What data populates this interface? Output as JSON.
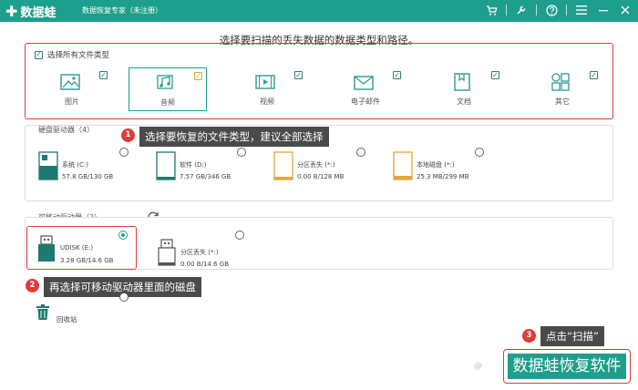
{
  "app": {
    "name": "数据蛙",
    "subtitle": "数据恢复专家（未注册）"
  },
  "instruction": "选择要扫描的丢失数据的数据类型和路径。",
  "file_types": {
    "select_all_label": "选择所有文件类型",
    "items": [
      {
        "label": "图片",
        "icon": "image-icon"
      },
      {
        "label": "音频",
        "icon": "audio-icon"
      },
      {
        "label": "视频",
        "icon": "video-icon"
      },
      {
        "label": "电子邮件",
        "icon": "email-icon"
      },
      {
        "label": "文档",
        "icon": "document-icon"
      },
      {
        "label": "其它",
        "icon": "other-icon"
      }
    ]
  },
  "callouts": {
    "c1": {
      "num": "1",
      "text": "选择要恢复的文件类型，建议全部选择"
    },
    "c2": {
      "num": "2",
      "text": "再选择可移动驱动器里面的磁盘"
    },
    "c3": {
      "num": "3",
      "text": "点击“扫描”"
    }
  },
  "hard_drives": {
    "title": "硬盘驱动器（4）",
    "items": [
      {
        "name": "系统 (C:)",
        "size": "57.8 GB/130 GB"
      },
      {
        "name": "软件 (D:)",
        "size": "7.57 GB/346 GB"
      },
      {
        "name": "分区丢失 (*:)",
        "size": "0.00  B/128 MB"
      },
      {
        "name": "本地磁盘 (*:)",
        "size": "25.3 MB/299 MB"
      }
    ]
  },
  "removable_drives": {
    "title": "可移动驱动器（2）",
    "items": [
      {
        "name": "UDISK (E:)",
        "size": "3.28 GB/14.6 GB"
      },
      {
        "name": "分区丢失 (*:)",
        "size": "0.00  B/14.6 GB"
      }
    ]
  },
  "recycle_bin": {
    "label": "回收站"
  },
  "scan_button": {
    "label": "数据蛙恢复软件"
  },
  "watermark": "@",
  "colors": {
    "accent": "#1e9e8c",
    "highlight": "#e03a3a",
    "callout_bg": "#4a4a4a",
    "orange": "#e8a33a"
  }
}
